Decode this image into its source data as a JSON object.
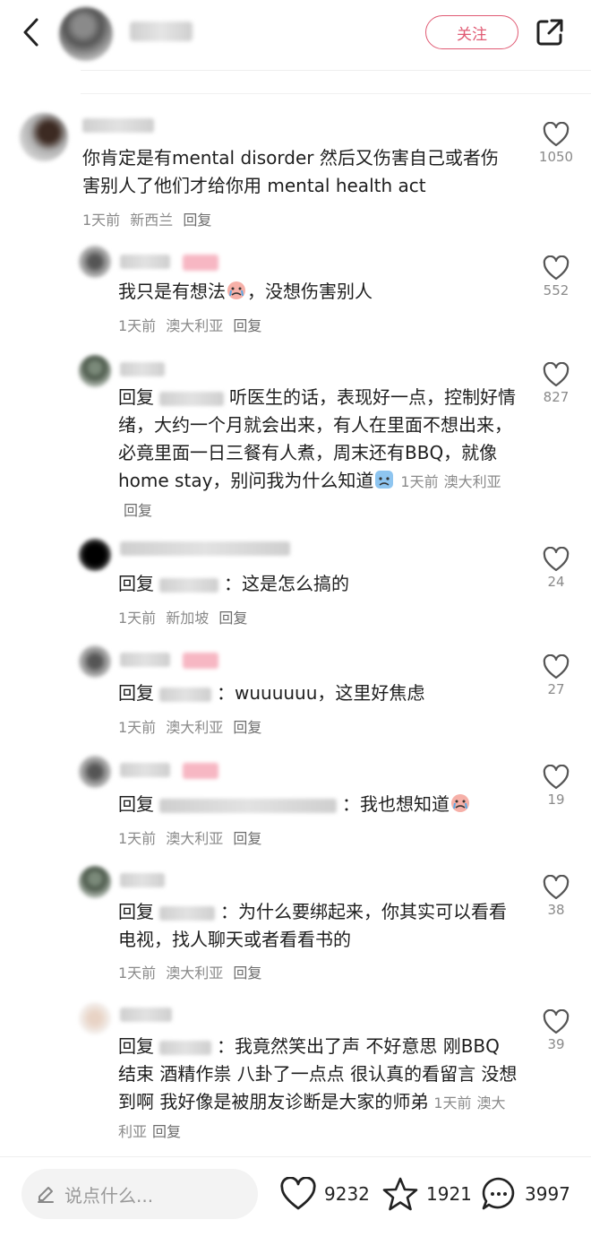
{
  "header": {
    "follow_label": "关注"
  },
  "comments": [
    {
      "text": "你肯定是有mental disorder 然后又伤害自己或者伤害别人了他们才给你用 mental health act",
      "time": "1天前",
      "location": "新西兰",
      "reply": "回复",
      "likes": "1050"
    },
    {
      "text": "我只是有想法",
      "text_after": "，没想伤害别人",
      "time": "1天前",
      "location": "澳大利亚",
      "reply": "回复",
      "likes": "552"
    },
    {
      "prefix": "回复",
      "text": "听医生的话，表现好一点，控制好情绪，大约一个月就会出来，有人在里面不想出来，必竟里面一日三餐有人煮，周末还有BBQ，就像home stay，别问我为什么知道",
      "time": "1天前",
      "location": "澳大利亚",
      "reply": "回复",
      "likes": "827"
    },
    {
      "prefix": "回复",
      "text": "：这是怎么搞的",
      "time": "1天前",
      "location": "新加坡",
      "reply": "回复",
      "likes": "24"
    },
    {
      "prefix": "回复",
      "text": "：wuuuuuu，这里好焦虑",
      "time": "1天前",
      "location": "澳大利亚",
      "reply": "回复",
      "likes": "27"
    },
    {
      "prefix": "回复",
      "text": "：我也想知道",
      "time": "1天前",
      "location": "澳大利亚",
      "reply": "回复",
      "likes": "19"
    },
    {
      "prefix": "回复",
      "text": "：为什么要绑起来，你其实可以看看电视，找人聊天或者看看书的",
      "time": "1天前",
      "location": "澳大利亚",
      "reply": "回复",
      "likes": "38"
    },
    {
      "prefix": "回复",
      "text": "：我竟然笑出了声 不好意思 刚BBQ 结束 酒精作祟 八卦了一点点 很认真的看留言 没想到啊 我好像是被朋友诊断是大家的师弟",
      "time": "1天前",
      "location": "澳大利亚",
      "reply": "回复",
      "likes": "39"
    }
  ],
  "bottom": {
    "input_placeholder": "说点什么...",
    "likes": "9232",
    "collects": "1921",
    "comments": "3997"
  },
  "icons": {
    "back": "chevron-left-icon",
    "share": "share-icon",
    "heart": "heart-icon",
    "star": "star-icon",
    "chat": "chat-bubble-icon",
    "pen": "pen-icon",
    "emoji": "crying-face-emoji"
  },
  "colors": {
    "accent": "#e05a73",
    "meta": "#8a8a8a"
  }
}
